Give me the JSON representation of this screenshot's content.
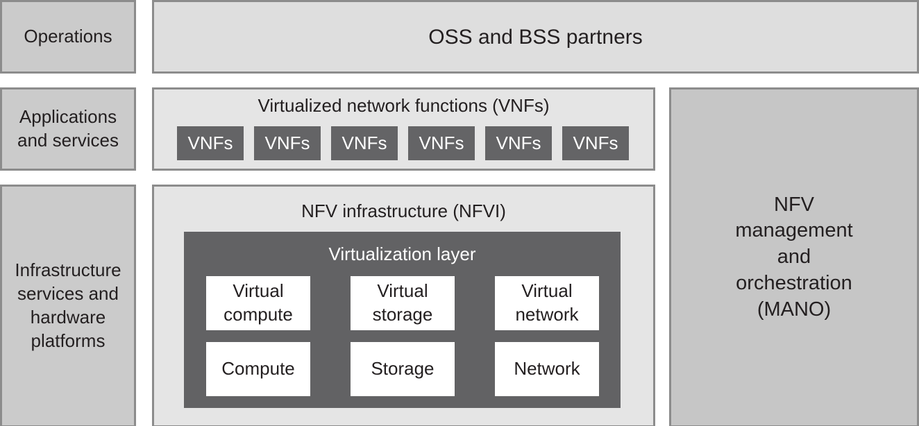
{
  "layers": {
    "operations": "Operations",
    "applications": "Applications and services",
    "infrastructure": "Infrastructure services and hardware platforms"
  },
  "oss_bss": "OSS and BSS partners",
  "vnf_block": {
    "title": "Virtualized network functions (VNFs)",
    "items": [
      "VNFs",
      "VNFs",
      "VNFs",
      "VNFs",
      "VNFs",
      "VNFs"
    ]
  },
  "nfvi": {
    "title": "NFV infrastructure (NFVI)",
    "virtualization_layer": {
      "title": "Virtualization layer",
      "virtual": [
        "Virtual compute",
        "Virtual storage",
        "Virtual network"
      ],
      "physical": [
        "Compute",
        "Storage",
        "Network"
      ]
    }
  },
  "mano": "NFV management and orchestration (MANO)"
}
